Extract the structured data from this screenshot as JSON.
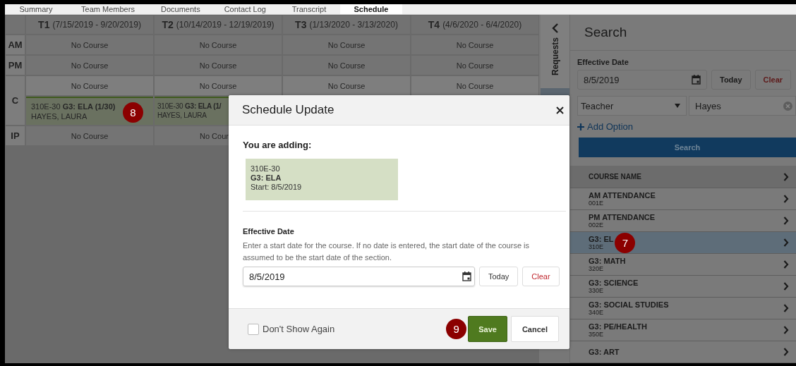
{
  "tabs": [
    {
      "label": "Summary",
      "selected": false
    },
    {
      "label": "Team Members",
      "selected": false
    },
    {
      "label": "Documents",
      "selected": false
    },
    {
      "label": "Contact Log",
      "selected": false
    },
    {
      "label": "Transcript",
      "selected": false
    },
    {
      "label": "Schedule",
      "selected": true
    }
  ],
  "schedule": {
    "terms": [
      {
        "code": "T1",
        "dates": "(7/15/2019 - 9/20/2019)"
      },
      {
        "code": "T2",
        "dates": "(10/14/2019 - 12/19/2019)"
      },
      {
        "code": "T3",
        "dates": "(1/13/2020 - 3/13/2020)"
      },
      {
        "code": "T4",
        "dates": "(4/6/2020 - 6/4/2020)"
      }
    ],
    "periods": [
      {
        "label": "AM",
        "cells": [
          {
            "text": "No Course",
            "cut": false
          },
          {
            "text": "No Course",
            "cut": false
          },
          {
            "text": "No Course",
            "cut": false
          },
          {
            "text": "No Course",
            "cut": false
          }
        ]
      },
      {
        "label": "PM",
        "cells": [
          {
            "text": "No Course",
            "cut": false
          },
          {
            "text": "No Course",
            "cut": false
          },
          {
            "text": "No Course",
            "cut": false
          },
          {
            "text": "No Course",
            "cut": false
          }
        ]
      },
      {
        "label": "C",
        "cells": [
          {
            "text": "No Course",
            "cut": false
          },
          {
            "text": "No Course",
            "cut": false
          },
          {
            "text": "No Course",
            "cut": false
          },
          {
            "text": "No Course",
            "cut": false
          }
        ],
        "sections": [
          {
            "code": "310E-30",
            "name": "G3: ELA (1/30)",
            "teacher": "HAYES, LAURA",
            "callout": "8",
            "cut": false
          },
          {
            "code": "310E-30",
            "name": "G3: ELA (1/",
            "teacher": "HAYES, LAURA",
            "cut": true
          }
        ]
      },
      {
        "label": "IP",
        "cells": [
          {
            "text": "No Course",
            "cut": false
          },
          {
            "text": "No Cour",
            "cut": true
          }
        ]
      }
    ]
  },
  "requests_tab": {
    "label": "Requests"
  },
  "search_panel": {
    "title": "Search",
    "date_label": "Effective Date",
    "date": "8/5/2019",
    "today": "Today",
    "clear": "Clear",
    "filter_field": "Teacher",
    "filter_value": "Hayes",
    "add_option": "Add Option",
    "search_button": "Search",
    "list_header": "COURSE NAME",
    "courses": [
      {
        "name": "AM ATTENDANCE",
        "code": "001E",
        "selected": false
      },
      {
        "name": "PM ATTENDANCE",
        "code": "002E",
        "selected": false
      },
      {
        "name": "G3: EL",
        "code": "310E",
        "selected": true,
        "callout": "7"
      },
      {
        "name": "G3: MATH",
        "code": "320E",
        "selected": false
      },
      {
        "name": "G3: SCIENCE",
        "code": "330E",
        "selected": false
      },
      {
        "name": "G3: SOCIAL STUDIES",
        "code": "340E",
        "selected": false
      },
      {
        "name": "G3: PE/HEALTH",
        "code": "350E",
        "selected": false
      },
      {
        "name": "G3: ART",
        "selected": false
      }
    ]
  },
  "dialog": {
    "title": "Schedule Update",
    "adding_label": "You are adding:",
    "adding_lines": [
      "310E-30",
      "**G3: ELA**",
      "Start: 8/5/2019"
    ],
    "date_label": "Effective Date",
    "help": "Enter a start date for the course. If no date is entered, the start date of the course is assumed to be the start date of the section.",
    "date": "8/5/2019",
    "today": "Today",
    "clear": "Clear",
    "dont_show": {
      "label": "Don't Show Again",
      "checked": false
    },
    "save_callout": "9",
    "save": "Save",
    "cancel": "Cancel"
  }
}
